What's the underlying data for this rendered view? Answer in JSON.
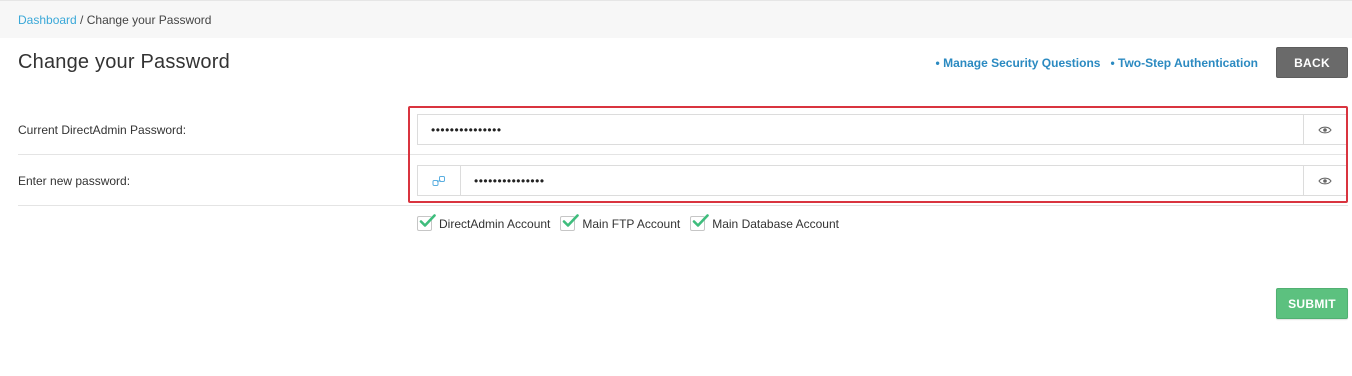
{
  "breadcrumb": {
    "home": "Dashboard",
    "separator": " / ",
    "current": "Change your Password"
  },
  "page_title": "Change your Password",
  "header_links": [
    {
      "label": "• Manage Security Questions"
    },
    {
      "label": "• Two-Step Authentication"
    }
  ],
  "back_label": "BACK",
  "fields": {
    "current_password": {
      "label": "Current DirectAdmin Password:",
      "value": "•••••••••••••••",
      "icon": "eye-icon"
    },
    "new_password": {
      "label": "Enter new password:",
      "value": "•••••••••••••••",
      "left_icon": "link-icon",
      "icon": "eye-icon"
    }
  },
  "checkboxes": [
    {
      "label": "DirectAdmin Account",
      "checked": true
    },
    {
      "label": "Main FTP Account",
      "checked": true
    },
    {
      "label": "Main Database Account",
      "checked": true
    }
  ],
  "submit_label": "SUBMIT",
  "colors": {
    "link": "#3aa8d8",
    "header_link": "#2b8ac1",
    "back_button": "#6a6a6a",
    "submit_button": "#5cc17f",
    "check_mark": "#3fbd7d",
    "highlight": "#d9343f"
  }
}
